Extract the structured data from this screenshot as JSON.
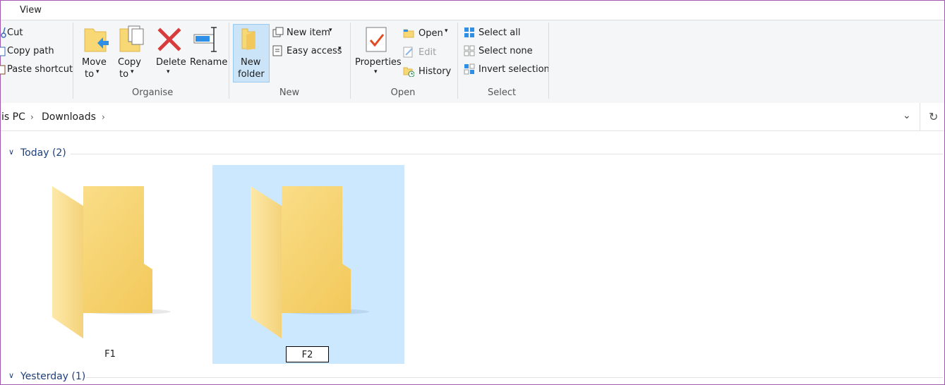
{
  "tabs": {
    "view": "View"
  },
  "clipboard": {
    "cut": "Cut",
    "copy_path": "Copy path",
    "paste_shortcut": "Paste shortcut"
  },
  "organise": {
    "move_to_1": "Move",
    "move_to_2": "to",
    "copy_to_1": "Copy",
    "copy_to_2": "to",
    "delete": "Delete",
    "rename": "Rename",
    "group_label": "Organise"
  },
  "new": {
    "new_folder_1": "New",
    "new_folder_2": "folder",
    "new_item": "New item",
    "easy_access": "Easy access",
    "group_label": "New"
  },
  "open": {
    "properties": "Properties",
    "open": "Open",
    "edit": "Edit",
    "history": "History",
    "group_label": "Open"
  },
  "select": {
    "select_all": "Select all",
    "select_none": "Select none",
    "invert_selection": "Invert selection",
    "group_label": "Select"
  },
  "address": {
    "this_pc": "is PC",
    "downloads": "Downloads"
  },
  "groups": {
    "today": "Today (2)",
    "yesterday": "Yesterday (1)"
  },
  "items": {
    "f1": "F1",
    "f2_rename_value": "F2"
  },
  "colors": {
    "accent": "#cce8ff",
    "folder": "#f8d775",
    "delete_red": "#d83b3b",
    "group_header": "#1e3f7a"
  }
}
